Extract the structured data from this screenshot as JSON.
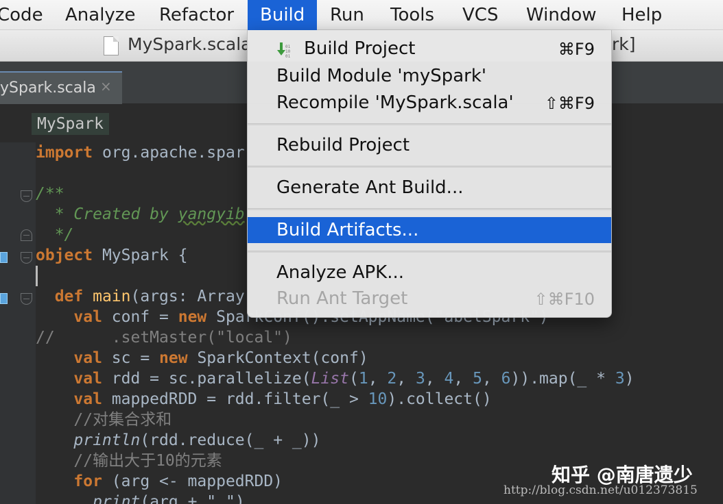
{
  "menubar": {
    "items": [
      "Code",
      "Analyze",
      "Refactor",
      "Build",
      "Run",
      "Tools",
      "VCS",
      "Window",
      "Help"
    ],
    "active": "Build"
  },
  "titlebar": {
    "file_name": "MySpark.scala",
    "suffix": "rk]"
  },
  "tab": {
    "label": "ySpark.scala",
    "close": "×"
  },
  "breadcrumb": "MySpark",
  "build_menu": {
    "items": [
      {
        "label": "Build Project",
        "shortcut": "⌘F9",
        "icon": "build-arrow-icon"
      },
      {
        "label": "Build Module 'mySpark'",
        "shortcut": ""
      },
      {
        "label": "Recompile 'MySpark.scala'",
        "shortcut": "⇧⌘F9"
      },
      {
        "label": "Rebuild Project",
        "shortcut": ""
      },
      {
        "label": "Generate Ant Build...",
        "shortcut": ""
      },
      {
        "label": "Build Artifacts...",
        "shortcut": "",
        "highlighted": true
      },
      {
        "label": "Analyze APK...",
        "shortcut": ""
      },
      {
        "label": "Run Ant Target",
        "shortcut": "⇧⌘F10",
        "disabled": true
      }
    ]
  },
  "code": {
    "line1": "org.apache.spar",
    "doc_created": "* Created by ",
    "doc_author": "yangyib",
    "doc_end": "*/",
    "object_name": " MySpark {",
    "main_sig": "(args: Array",
    "conf_rest": "SparkConf().setAppName(\"abelSpark\")",
    "master_comment": "//      .setMaster(\"local\")",
    "sc_rest": "SparkContext(conf)",
    "rdd_rest_a": " rdd = sc.parallelize(",
    "rdd_list": "List",
    "rdd_rest_b": ")).map(_ * ",
    "mapped_rest_a": " mappedRDD = rdd.filter(_ > ",
    "mapped_rest_b": ").collect()",
    "comment1": "//对集合求和",
    "println": "println",
    "reduce_rest": "(rdd.reduce(_ + _))",
    "comment2": "//输出大于10的元素",
    "for_rest": " (arg <- mappedRDD)",
    "print": "print",
    "print_rest": "(arg + \" \")"
  },
  "watermark": {
    "zhihu": "知乎 @南唐遗少",
    "url": "http://blog.csdn.net/u012373815"
  },
  "colors": {
    "menu_highlight": "#1a63d6",
    "editor_bg": "#2b2b2b",
    "keyword": "#cc7832",
    "doc_comment": "#629755"
  }
}
